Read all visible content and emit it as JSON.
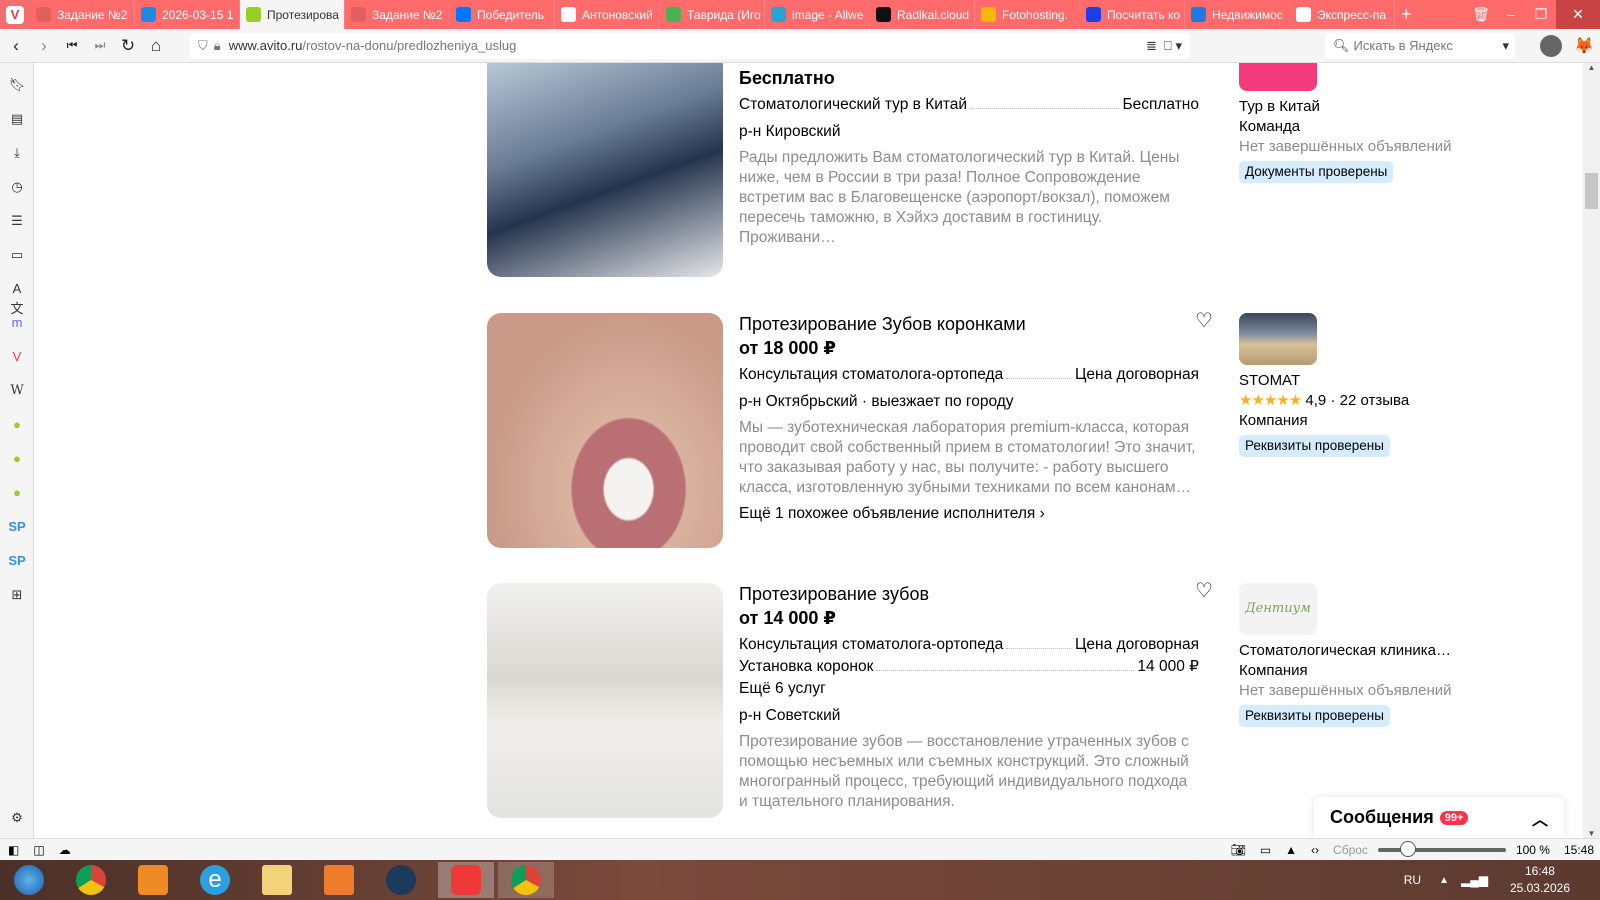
{
  "browser": {
    "tabs": [
      {
        "label": "Задание №2",
        "icon": "sp-icon",
        "color": "#e06060"
      },
      {
        "label": "2026-03-15 1",
        "icon": "cloud-icon",
        "color": "#1e88e5"
      },
      {
        "label": "Протезирова",
        "icon": "avito-icon",
        "color": "#97cf26",
        "active": true
      },
      {
        "label": "Задание №2",
        "icon": "sp-icon",
        "color": "#e06060"
      },
      {
        "label": "Победитель",
        "icon": "vk-icon",
        "color": "#0077ff"
      },
      {
        "label": "Антоновский",
        "icon": "doc-icon",
        "color": "#ffffff"
      },
      {
        "label": "Таврида (Иго",
        "icon": "green-square-icon",
        "color": "#4caf50"
      },
      {
        "label": "image - Allwe",
        "icon": "image-icon",
        "color": "#29a3d6"
      },
      {
        "label": "Radikal.cloud",
        "icon": "radikal-icon",
        "color": "#111111"
      },
      {
        "label": "Fotohosting.",
        "icon": "fotohosting-icon",
        "color": "#f5b90a"
      },
      {
        "label": "Посчитать ко",
        "icon": "blue-dot-icon",
        "color": "#1a3ee8"
      },
      {
        "label": "Недвижимос",
        "icon": "flower-icon",
        "color": "#1f7ae0"
      },
      {
        "label": "Экспресс-па",
        "icon": "grid-icon",
        "color": "#ffffff"
      }
    ],
    "url_domain": "www.avito.ru",
    "url_path": "/rostov-na-donu/predlozheniya_uslug",
    "search_placeholder": "Искать в Яндекс",
    "zoom_reset": "Сброс",
    "zoom_level": "100 %",
    "zoom_fraction": 0.2,
    "clock": "15:48"
  },
  "listings": [
    {
      "title": "",
      "price": "Бесплатно",
      "services": [
        {
          "name": "Стоматологический тур в Китай",
          "price": "Бесплатно"
        }
      ],
      "location": "р-н Кировский",
      "description": "Рады предложить Вам стоматологический тур в Китай. Цены ниже, чем в России в три раза! Полное Сопровождение встретим вас в Благовещенске (аэропорт/вокзал), поможем пересечь таможню, в Хэйхэ доставим в гостиницу. Проживани…",
      "seller": {
        "name": "Тур в Китай",
        "type": "Команда",
        "stats": "Нет завершённых объявлений",
        "badge": "Документы проверены"
      }
    },
    {
      "title": "Протезирование Зубов коронками",
      "price": "от 18 000 ₽",
      "services": [
        {
          "name": "Консультация стоматолога-ортопеда",
          "price": "Цена договорная"
        }
      ],
      "location": "р-н Октябрьский · выезжает по городу",
      "description": "Мы — зуботехническая лаборатория premium-класса, которая проводит свой собственный прием в стоматологии! Это значит, что заказывая работу у нас, вы получите: - работу высшего класса, изготовленную зубными техниками по всем канонам…",
      "more": "Ещё 1 похожее объявление исполнителя",
      "seller": {
        "name": "STOMAT",
        "rating": "4,9",
        "reviews": "22 отзыва",
        "type": "Компания",
        "badge": "Реквизиты проверены"
      }
    },
    {
      "title": "Протезирование зубов",
      "price": "от 14 000 ₽",
      "services": [
        {
          "name": "Консультация стоматолога-ортопеда",
          "price": "Цена договорная"
        },
        {
          "name": "Установка коронок",
          "price": "14 000 ₽"
        }
      ],
      "more_services": "Ещё 6 услуг",
      "location": "р-н Советский",
      "description": "Протезирование зубов — восстановление утраченных зубов с помощью несъемных или съемных конструкций. Это сложный многогранный процесс, требующий индивидуального подхода и тщательного планирования.",
      "seller": {
        "name": "Стоматологическая клиника…",
        "logo_text": "Дентиум",
        "type": "Компания",
        "stats": "Нет завершённых объявлений",
        "badge": "Реквизиты проверены"
      }
    }
  ],
  "messages": {
    "label": "Сообщения",
    "count": "99+"
  },
  "taskbar": {
    "lang": "RU",
    "time": "16:48",
    "date": "25.03.2026"
  }
}
